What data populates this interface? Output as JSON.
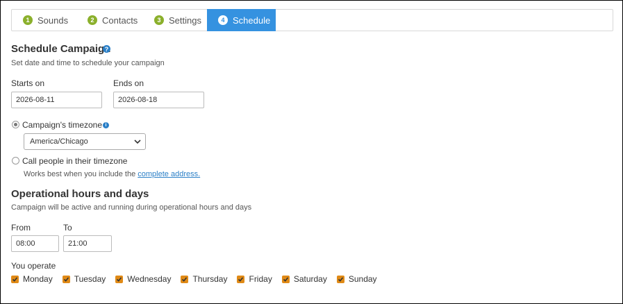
{
  "tabs": [
    {
      "num": "1",
      "label": "Sounds"
    },
    {
      "num": "2",
      "label": "Contacts"
    },
    {
      "num": "3",
      "label": "Settings"
    },
    {
      "num": "4",
      "label": "Schedule"
    }
  ],
  "schedule": {
    "title": "Schedule Campaign",
    "subtitle": "Set date and time to schedule your campaign",
    "starts_label": "Starts on",
    "starts_value": "2026-08-11",
    "ends_label": "Ends on",
    "ends_value": "2026-08-18",
    "campaign_tz_label": "Campaign's timezone",
    "timezone_value": "America/Chicago",
    "people_tz_label": "Call people in their timezone",
    "hint_text": "Works best when you include the",
    "hint_link": "complete address."
  },
  "hours": {
    "title": "Operational hours and days",
    "subtitle": "Campaign will be active and running during operational hours and days",
    "from_label": "From",
    "from_value": "08:00",
    "to_label": "To",
    "to_value": "21:00",
    "operate_label": "You operate",
    "days": [
      "Monday",
      "Tuesday",
      "Wednesday",
      "Thursday",
      "Friday",
      "Saturday",
      "Sunday"
    ]
  },
  "colors": {
    "accent": "#3592e0",
    "step_badge": "#8bb02c",
    "checkbox": "#e08a16",
    "link": "#2a7fc7"
  }
}
